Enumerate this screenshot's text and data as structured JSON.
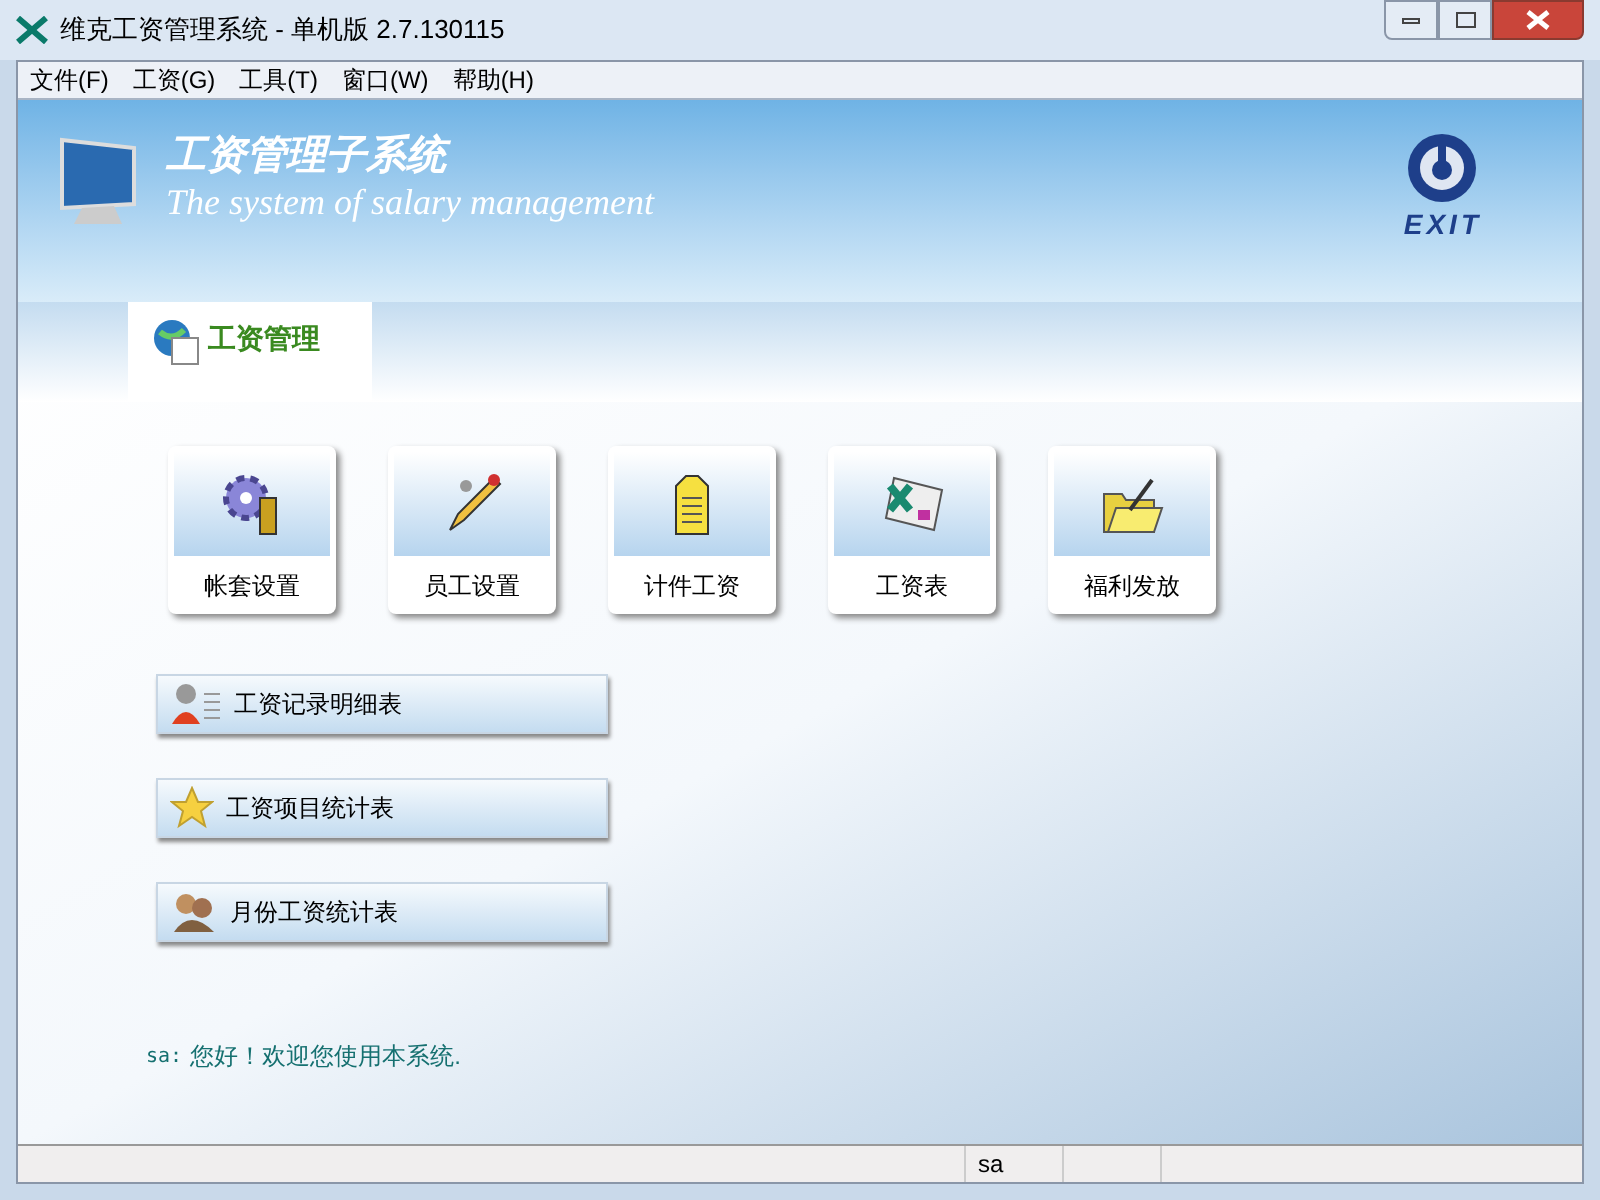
{
  "window": {
    "title": "维克工资管理系统 - 单机版 2.7.130115"
  },
  "menu": [
    "文件(F)",
    "工资(G)",
    "工具(T)",
    "窗口(W)",
    "帮助(H)"
  ],
  "banner": {
    "title": "工资管理子系统",
    "subtitle": "The system of salary management",
    "exit_label": "EXIT"
  },
  "tabs": [
    {
      "label": "工资管理",
      "selected": true
    }
  ],
  "tiles": [
    {
      "label": "帐套设置",
      "kind": "gear"
    },
    {
      "label": "员工设置",
      "kind": "pencil"
    },
    {
      "label": "计件工资",
      "kind": "tag"
    },
    {
      "label": "工资表",
      "kind": "sheet"
    },
    {
      "label": "福利发放",
      "kind": "folder"
    }
  ],
  "reports": [
    {
      "label": "工资记录明细表",
      "kind": "person"
    },
    {
      "label": "工资项目统计表",
      "kind": "star"
    },
    {
      "label": "月份工资统计表",
      "kind": "people"
    }
  ],
  "welcome": {
    "user": "sa:",
    "message": "您好！欢迎您使用本系统."
  },
  "status_bar": {
    "user": "sa"
  }
}
